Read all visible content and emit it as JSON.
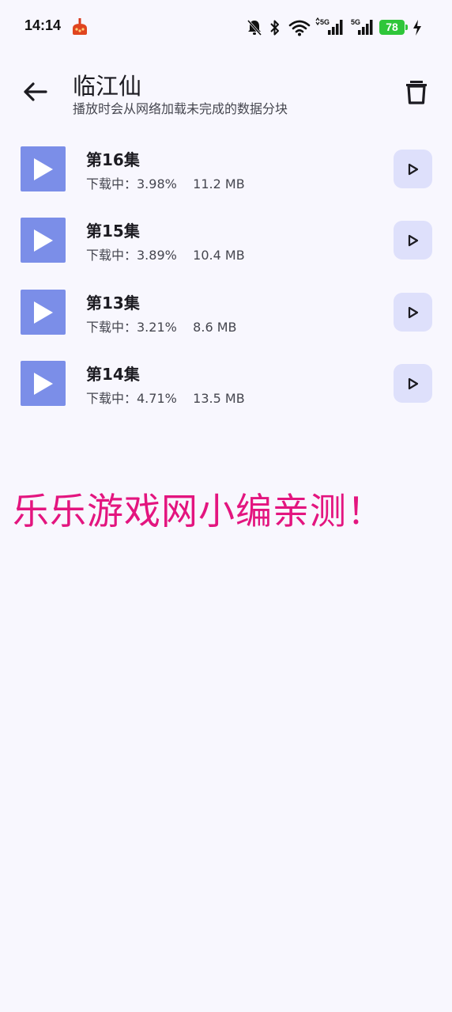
{
  "status_bar": {
    "time": "14:14",
    "battery": "78",
    "icons": [
      "notification-app-icon",
      "mute-bell-icon",
      "bluetooth-icon",
      "wifi-icon",
      "signal-5g-icon",
      "signal-5g-icon",
      "battery-icon",
      "charging-icon"
    ]
  },
  "app_bar": {
    "title": "临江仙",
    "subtitle": "播放时会从网络加载未完成的数据分块",
    "back_icon": "arrow-left-icon",
    "delete_icon": "trash-icon"
  },
  "episodes": [
    {
      "title": "第16集",
      "status": "下载中：3.98%    11.2 MB"
    },
    {
      "title": "第15集",
      "status": "下载中：3.89%    10.4 MB"
    },
    {
      "title": "第13集",
      "status": "下载中：3.21%    8.6 MB"
    },
    {
      "title": "第14集",
      "status": "下载中：4.71%    13.5 MB"
    }
  ],
  "watermark": "乐乐游戏网小编亲测！",
  "colors": {
    "background": "#f8f7fe",
    "thumbnail": "#7b8ee8",
    "play_button_bg": "#dee0fb",
    "watermark": "#e3157f",
    "battery": "#2fc63a"
  }
}
